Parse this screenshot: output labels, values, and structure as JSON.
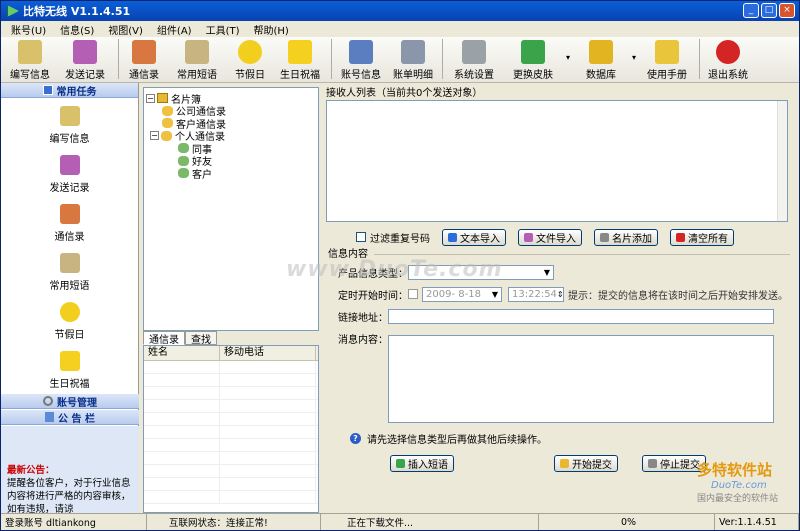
{
  "window": {
    "title": "比特无线 V1.1.4.51"
  },
  "menu": [
    "账号(U)",
    "信息(S)",
    "视图(V)",
    "组件(A)",
    "工具(T)",
    "帮助(H)"
  ],
  "toolbar": [
    {
      "label": "编写信息",
      "icon": "mail-write-icon",
      "color": "#d9c16b"
    },
    {
      "label": "发送记录",
      "icon": "send-record-icon",
      "color": "#b45fb4"
    },
    {
      "label": "通信录",
      "icon": "contacts-book-icon",
      "color": "#d87840"
    },
    {
      "label": "常用短语",
      "icon": "phrase-pen-icon",
      "color": "#c8b480"
    },
    {
      "label": "节假日",
      "icon": "smiley-icon",
      "color": "#f2cf1e"
    },
    {
      "label": "生日祝福",
      "icon": "star-icon",
      "color": "#f5d020"
    },
    {
      "label": "账号信息",
      "icon": "account-doc-icon",
      "color": "#5a7ec0"
    },
    {
      "label": "账单明细",
      "icon": "keyboard-icon",
      "color": "#8a96aa"
    },
    {
      "label": "系统设置",
      "icon": "gears-icon",
      "color": "#9aa2a8"
    },
    {
      "label": "更换皮肤",
      "icon": "skin-icon",
      "color": "#3aa44a"
    },
    {
      "label": "数据库",
      "icon": "database-icon",
      "color": "#e2b422"
    },
    {
      "label": "使用手册",
      "icon": "manual-help-icon",
      "color": "#e8c53a"
    },
    {
      "label": "退出系统",
      "icon": "power-icon",
      "color": "#d42424"
    }
  ],
  "sidebar": {
    "header": "常用任务",
    "items": [
      {
        "label": "编写信息",
        "icon": "mail-write-icon",
        "color": "#d9c16b"
      },
      {
        "label": "发送记录",
        "icon": "send-record-icon",
        "color": "#b45fb4"
      },
      {
        "label": "通信录",
        "icon": "contacts-book-icon",
        "color": "#d87840"
      },
      {
        "label": "常用短语",
        "icon": "phrase-pen-icon",
        "color": "#c8b480"
      },
      {
        "label": "节假日",
        "icon": "smiley-icon",
        "color": "#f2cf1e"
      },
      {
        "label": "生日祝福",
        "icon": "star-icon",
        "color": "#f5d020"
      }
    ],
    "section2": "账号管理",
    "section3": "公 告 栏",
    "notice_title": "最新公告：",
    "notice_body": "提醒各位客户，对于行业信息内容将进行严格的内容审核，如有违规，请谅"
  },
  "tree": {
    "root": "名片簿",
    "nodes": [
      {
        "label": "公司通信录",
        "level": 1
      },
      {
        "label": "客户通信录",
        "level": 1
      },
      {
        "label": "个人通信录",
        "level": 1
      },
      {
        "label": "同事",
        "level": 2
      },
      {
        "label": "好友",
        "level": 2
      },
      {
        "label": "客户",
        "level": 2
      }
    ]
  },
  "lefttabs": [
    "通信录",
    "查找"
  ],
  "contactlist": {
    "columns": [
      "姓名",
      "移动电话"
    ]
  },
  "recipients": {
    "title": "接收人列表（当前共0个发送对象）"
  },
  "filter": {
    "label": "过滤重复号码"
  },
  "import_buttons": [
    "文本导入",
    "文件导入",
    "名片添加",
    "清空所有"
  ],
  "info": {
    "group_title": "信息内容",
    "type_label": "产品信息类型：",
    "time_label": "定时开始时间：",
    "date_value": "2009- 8-18",
    "time_value": "13:22:54",
    "time_hint": "提示：提交的信息将在该时间之后开始安排发送。",
    "link_label": "链接地址：",
    "msg_label": "消息内容：",
    "tip": "请先选择信息类型后再做其他后续操作。"
  },
  "actions": {
    "insert": "插入短语",
    "start": "开始提交",
    "stop": "停止提交"
  },
  "status": {
    "account": "登录账号 dltiankong",
    "net": "互联网状态：连接正常!",
    "download": "正在下载文件...",
    "progress": "0%",
    "version": "Ver:1.1.4.51"
  },
  "watermark": "www.DuoTe.com",
  "brand": {
    "line1": "多特软件站",
    "line2": "DuoTe.com",
    "line3": "国内最安全的软件站"
  }
}
